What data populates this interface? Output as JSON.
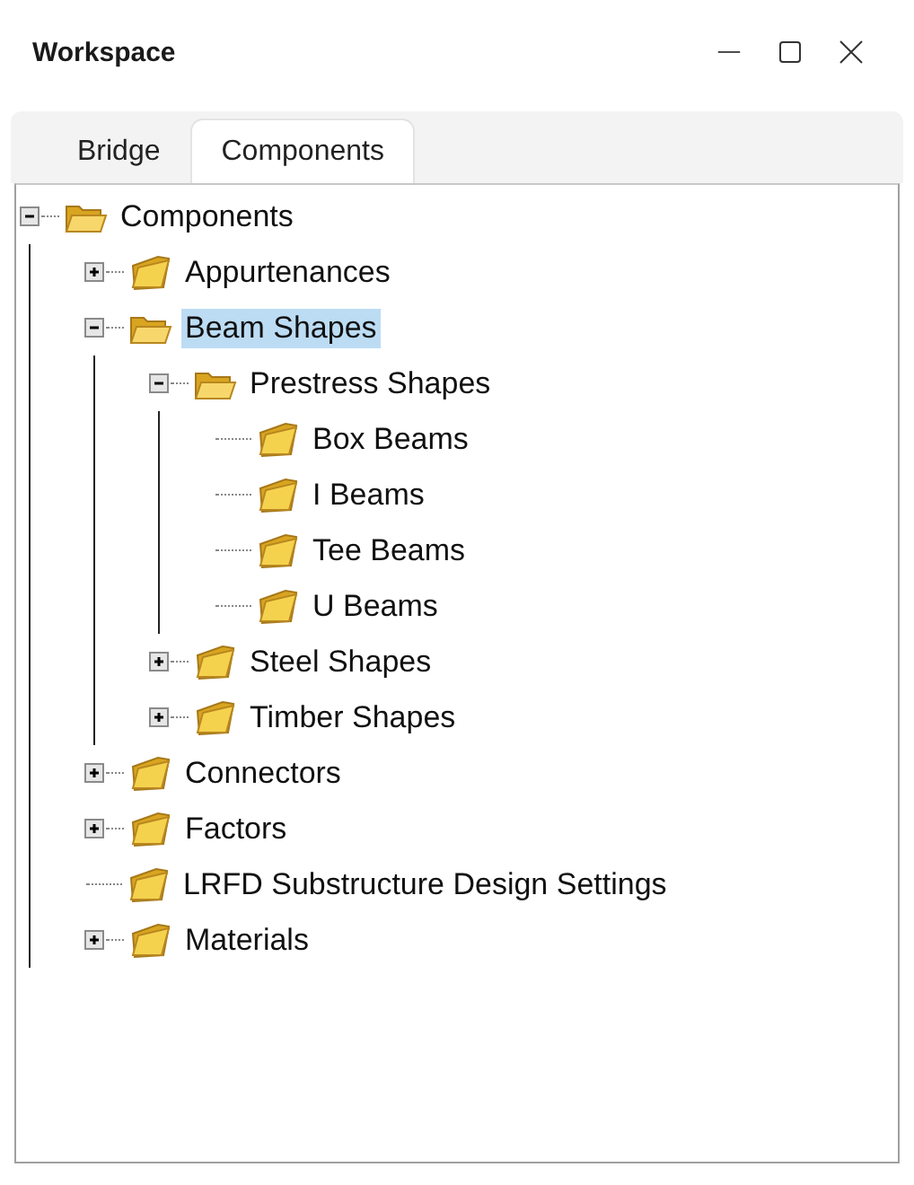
{
  "window": {
    "title": "Workspace"
  },
  "tabs": [
    {
      "label": "Bridge",
      "selected": false
    },
    {
      "label": "Components",
      "selected": true
    }
  ],
  "tree": [
    {
      "label": "Components",
      "expanded": true,
      "selected": false,
      "children": [
        {
          "label": "Appurtenances",
          "expanded": false,
          "selected": false
        },
        {
          "label": "Beam Shapes",
          "expanded": true,
          "selected": true,
          "children": [
            {
              "label": "Prestress Shapes",
              "expanded": true,
              "selected": false,
              "children": [
                {
                  "label": "Box Beams",
                  "selected": false
                },
                {
                  "label": "I Beams",
                  "selected": false
                },
                {
                  "label": "Tee Beams",
                  "selected": false
                },
                {
                  "label": "U Beams",
                  "selected": false
                }
              ]
            },
            {
              "label": "Steel Shapes",
              "expanded": false,
              "selected": false
            },
            {
              "label": "Timber Shapes",
              "expanded": false,
              "selected": false
            }
          ]
        },
        {
          "label": "Connectors",
          "expanded": false,
          "selected": false
        },
        {
          "label": "Factors",
          "expanded": false,
          "selected": false
        },
        {
          "label": "LRFD Substructure Design Settings",
          "selected": false
        },
        {
          "label": "Materials",
          "expanded": false,
          "selected": false
        }
      ]
    }
  ]
}
